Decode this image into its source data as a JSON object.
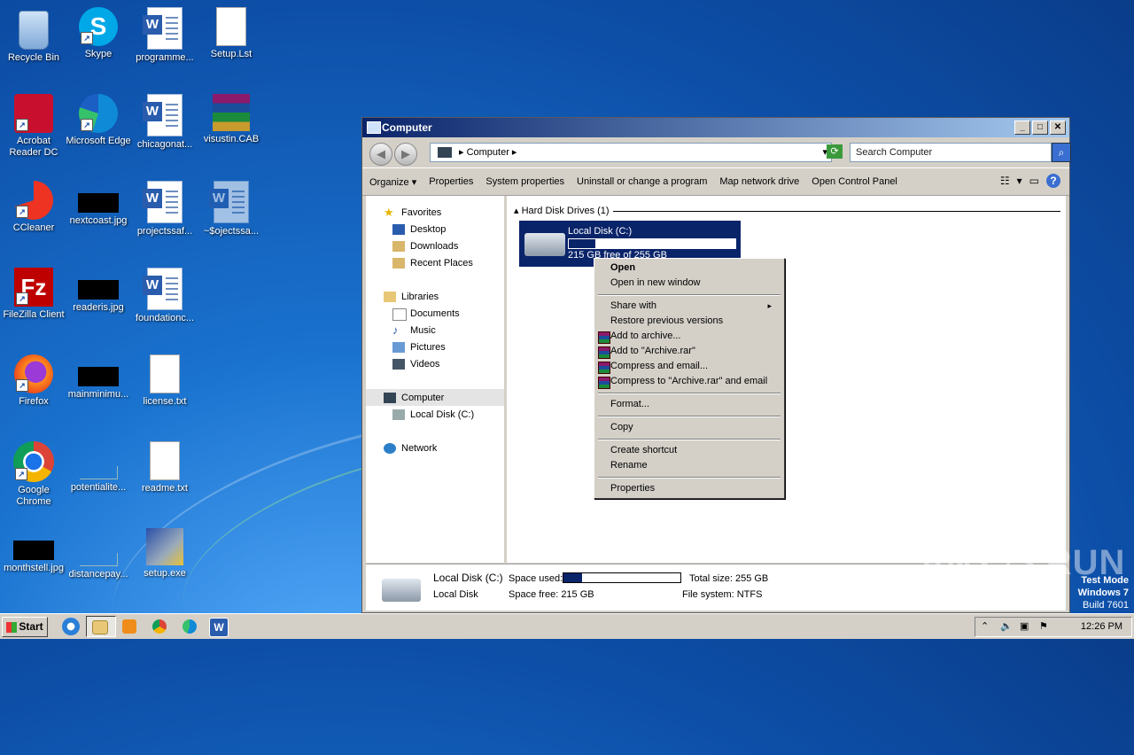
{
  "desktop": {
    "icons": [
      {
        "label": "Recycle Bin"
      },
      {
        "label": "Skype"
      },
      {
        "label": "programme..."
      },
      {
        "label": "Setup.Lst"
      },
      {
        "label": "Acrobat Reader DC"
      },
      {
        "label": "Microsoft Edge"
      },
      {
        "label": "chicagonat..."
      },
      {
        "label": "visustin.CAB"
      },
      {
        "label": "CCleaner"
      },
      {
        "label": "nextcoast.jpg"
      },
      {
        "label": "projectssaf..."
      },
      {
        "label": "~$ojectssa..."
      },
      {
        "label": "FileZilla Client"
      },
      {
        "label": "readeris.jpg"
      },
      {
        "label": "foundationc..."
      },
      {
        "label": "Firefox"
      },
      {
        "label": "mainminimu..."
      },
      {
        "label": "license.txt"
      },
      {
        "label": "Google Chrome"
      },
      {
        "label": "potentialite..."
      },
      {
        "label": "readme.txt"
      },
      {
        "label": "monthstell.jpg"
      },
      {
        "label": "distancepay..."
      },
      {
        "label": "setup.exe"
      }
    ]
  },
  "window": {
    "title": "Computer",
    "controls": {
      "minimize": "_",
      "maximize": "□",
      "close": "✕"
    },
    "address": "Computer",
    "search_placeholder": "Search Computer",
    "commands": [
      "Organize",
      "Properties",
      "System properties",
      "Uninstall or change a program",
      "Map network drive",
      "Open Control Panel"
    ],
    "organize_arrow": "▾",
    "nav": {
      "favorites": "Favorites",
      "desktop": "Desktop",
      "downloads": "Downloads",
      "recent": "Recent Places",
      "libraries": "Libraries",
      "documents": "Documents",
      "music": "Music",
      "pictures": "Pictures",
      "videos": "Videos",
      "computer": "Computer",
      "local_disk": "Local Disk (C:)",
      "network": "Network"
    },
    "group_header": "Hard Disk Drives (1)",
    "drive": {
      "name": "Local Disk (C:)",
      "free_text": "215 GB free of 255 GB",
      "used_fraction": 0.157
    },
    "details": {
      "name": "Local Disk (C:)",
      "type": "Local Disk",
      "space_used_label": "Space used:",
      "space_free": "Space free: 215 GB",
      "total_size": "Total size: 255 GB",
      "file_system": "File system: NTFS",
      "used_fraction": 0.157
    }
  },
  "context_menu": {
    "items": {
      "open": "Open",
      "open_new_window": "Open in new window",
      "share_with": "Share with",
      "restore": "Restore previous versions",
      "add_archive": "Add to archive...",
      "add_archive_rar": "Add to \"Archive.rar\"",
      "compress_email": "Compress and email...",
      "compress_rar_email": "Compress to \"Archive.rar\" and email",
      "format": "Format...",
      "copy": "Copy",
      "create_shortcut": "Create shortcut",
      "rename": "Rename",
      "properties": "Properties"
    },
    "submenu_arrow": "▸"
  },
  "taskbar": {
    "start": "Start",
    "clock": "12:26 PM"
  },
  "overlay": {
    "watermark": "ANY ▷ RUN",
    "test_mode": "Test Mode",
    "os": "Windows 7",
    "build": "Build 7601"
  }
}
